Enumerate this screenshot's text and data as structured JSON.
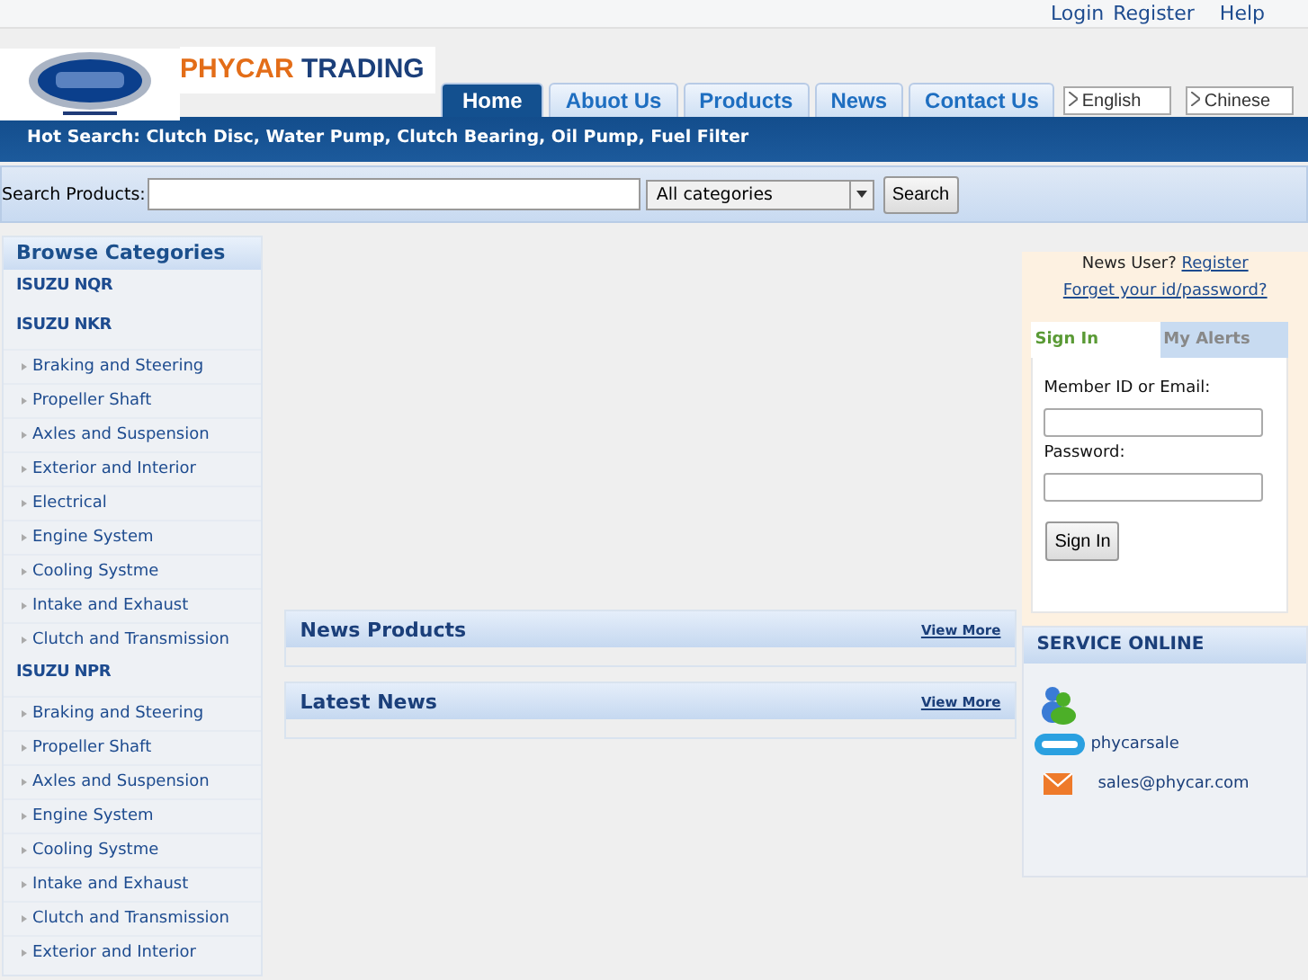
{
  "top_links": [
    "Login",
    "Register",
    "Help"
  ],
  "brand": {
    "part1": "PHYCAR",
    "part2": "TRADING"
  },
  "tabs": [
    {
      "label": "Home",
      "selected": true
    },
    {
      "label": "Abuot Us",
      "selected": false
    },
    {
      "label": "Products",
      "selected": false
    },
    {
      "label": "News",
      "selected": false
    },
    {
      "label": "Contact Us",
      "selected": false
    }
  ],
  "languages": [
    "English",
    "Chinese"
  ],
  "hot_search": "Hot Search: Clutch Disc, Water Pump, Clutch Bearing, Oil Pump, Fuel Filter",
  "search": {
    "label": "Search Products:",
    "category": "All categories",
    "button": "Search"
  },
  "sidebar": {
    "title": "Browse Categories",
    "items": [
      {
        "label": "ISUZU NQR"
      },
      {
        "label": "ISUZU NKR",
        "children": [
          {
            "label": "Braking and Steering"
          },
          {
            "label": "Propeller Shaft"
          },
          {
            "label": "Axles and Suspension"
          },
          {
            "label": "Exterior and Interior"
          },
          {
            "label": "Electrical"
          },
          {
            "label": "Engine System"
          },
          {
            "label": "Cooling Systme"
          },
          {
            "label": "Intake and Exhaust"
          },
          {
            "label": "Clutch and Transmission"
          }
        ]
      },
      {
        "label": "ISUZU NPR",
        "children": [
          {
            "label": "Braking and Steering"
          },
          {
            "label": "Propeller Shaft"
          },
          {
            "label": "Axles and Suspension"
          },
          {
            "label": "Engine System"
          },
          {
            "label": "Cooling Systme"
          },
          {
            "label": "Intake and Exhaust"
          },
          {
            "label": "Clutch and Transmission"
          },
          {
            "label": "Exterior and Interior"
          }
        ]
      }
    ]
  },
  "panels": [
    {
      "title": "News Products",
      "link": "View More"
    },
    {
      "title": "Latest News",
      "link": "View More"
    }
  ],
  "login": {
    "prompt": "News User?",
    "register": "Register",
    "forgot": "Forget your id/password?",
    "tabs": [
      {
        "label": "Sign In",
        "selected": true
      },
      {
        "label": "My Alerts",
        "selected": false
      }
    ],
    "member_label": "Member ID or Email:",
    "password_label": "Password:",
    "button": "Sign In"
  },
  "service": {
    "title": "SERVICE ONLINE",
    "contacts": [
      {
        "kind": "messenger"
      },
      {
        "kind": "skype",
        "text": "phycarsale"
      },
      {
        "kind": "email",
        "text": "sales@phycar.com"
      }
    ]
  }
}
